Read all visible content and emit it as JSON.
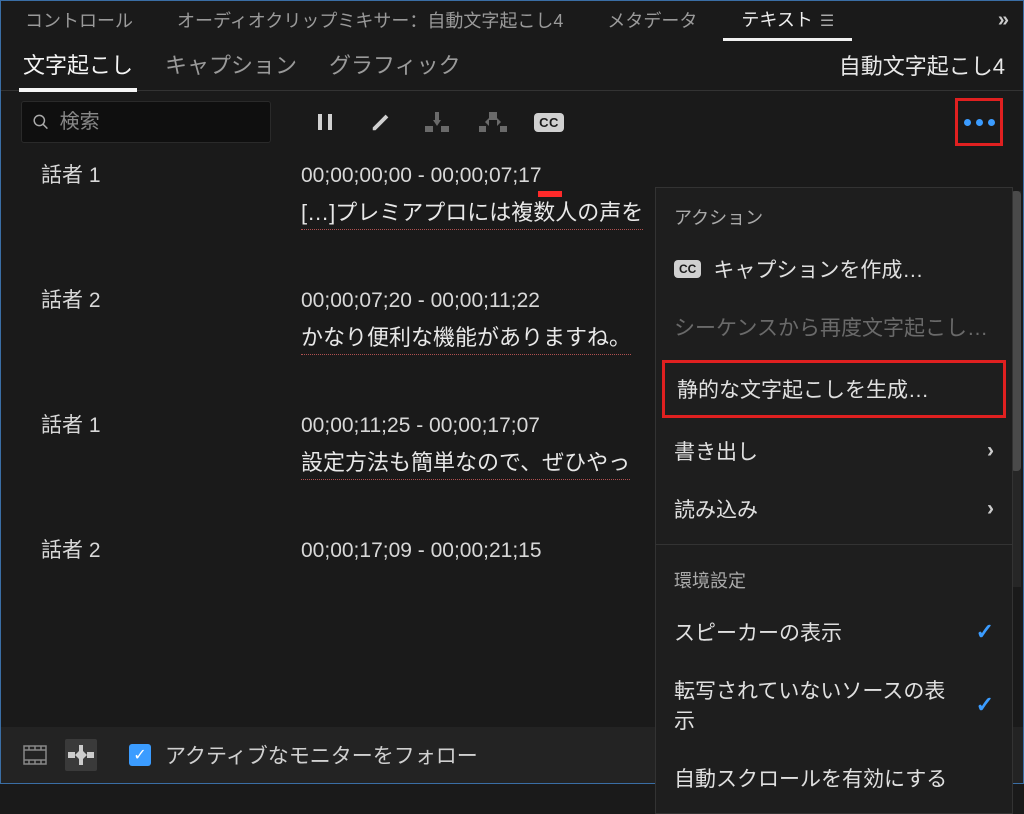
{
  "topTabs": {
    "items": [
      "コントロール",
      "オーディオクリップミキサー：自動文字起こし4",
      "メタデータ",
      "テキスト"
    ],
    "activeIndex": 3
  },
  "subTabs": {
    "items": [
      "文字起こし",
      "キャプション",
      "グラフィック"
    ],
    "activeIndex": 0
  },
  "panelTitle": "自動文字起こし4",
  "search": {
    "placeholder": "検索"
  },
  "segments": [
    {
      "speaker": "話者 1",
      "time": "00;00;00;00 - 00;00;07;17",
      "text": "[…]プレミアプロには複数人の声を"
    },
    {
      "speaker": "話者 2",
      "time": "00;00;07;20 - 00;00;11;22",
      "text": "かなり便利な機能がありますね。"
    },
    {
      "speaker": "話者 1",
      "time": "00;00;11;25 - 00;00;17;07",
      "text": "設定方法も簡単なので、ぜひやっ"
    },
    {
      "speaker": "話者 2",
      "time": "00;00;17;09 - 00;00;21;15",
      "text": ""
    }
  ],
  "footer": {
    "followLabel": "アクティブなモニターをフォロー"
  },
  "menu": {
    "actionHeader": "アクション",
    "createCaptions": "キャプションを作成…",
    "retranscribe": "シーケンスから再度文字起こし…",
    "static": "静的な文字起こしを生成…",
    "export": "書き出し",
    "import": "読み込み",
    "prefsHeader": "環境設定",
    "showSpeakers": "スピーカーの表示",
    "showUntranscribed": "転写されていないソースの表示",
    "autoscroll": "自動スクロールを有効にする"
  }
}
